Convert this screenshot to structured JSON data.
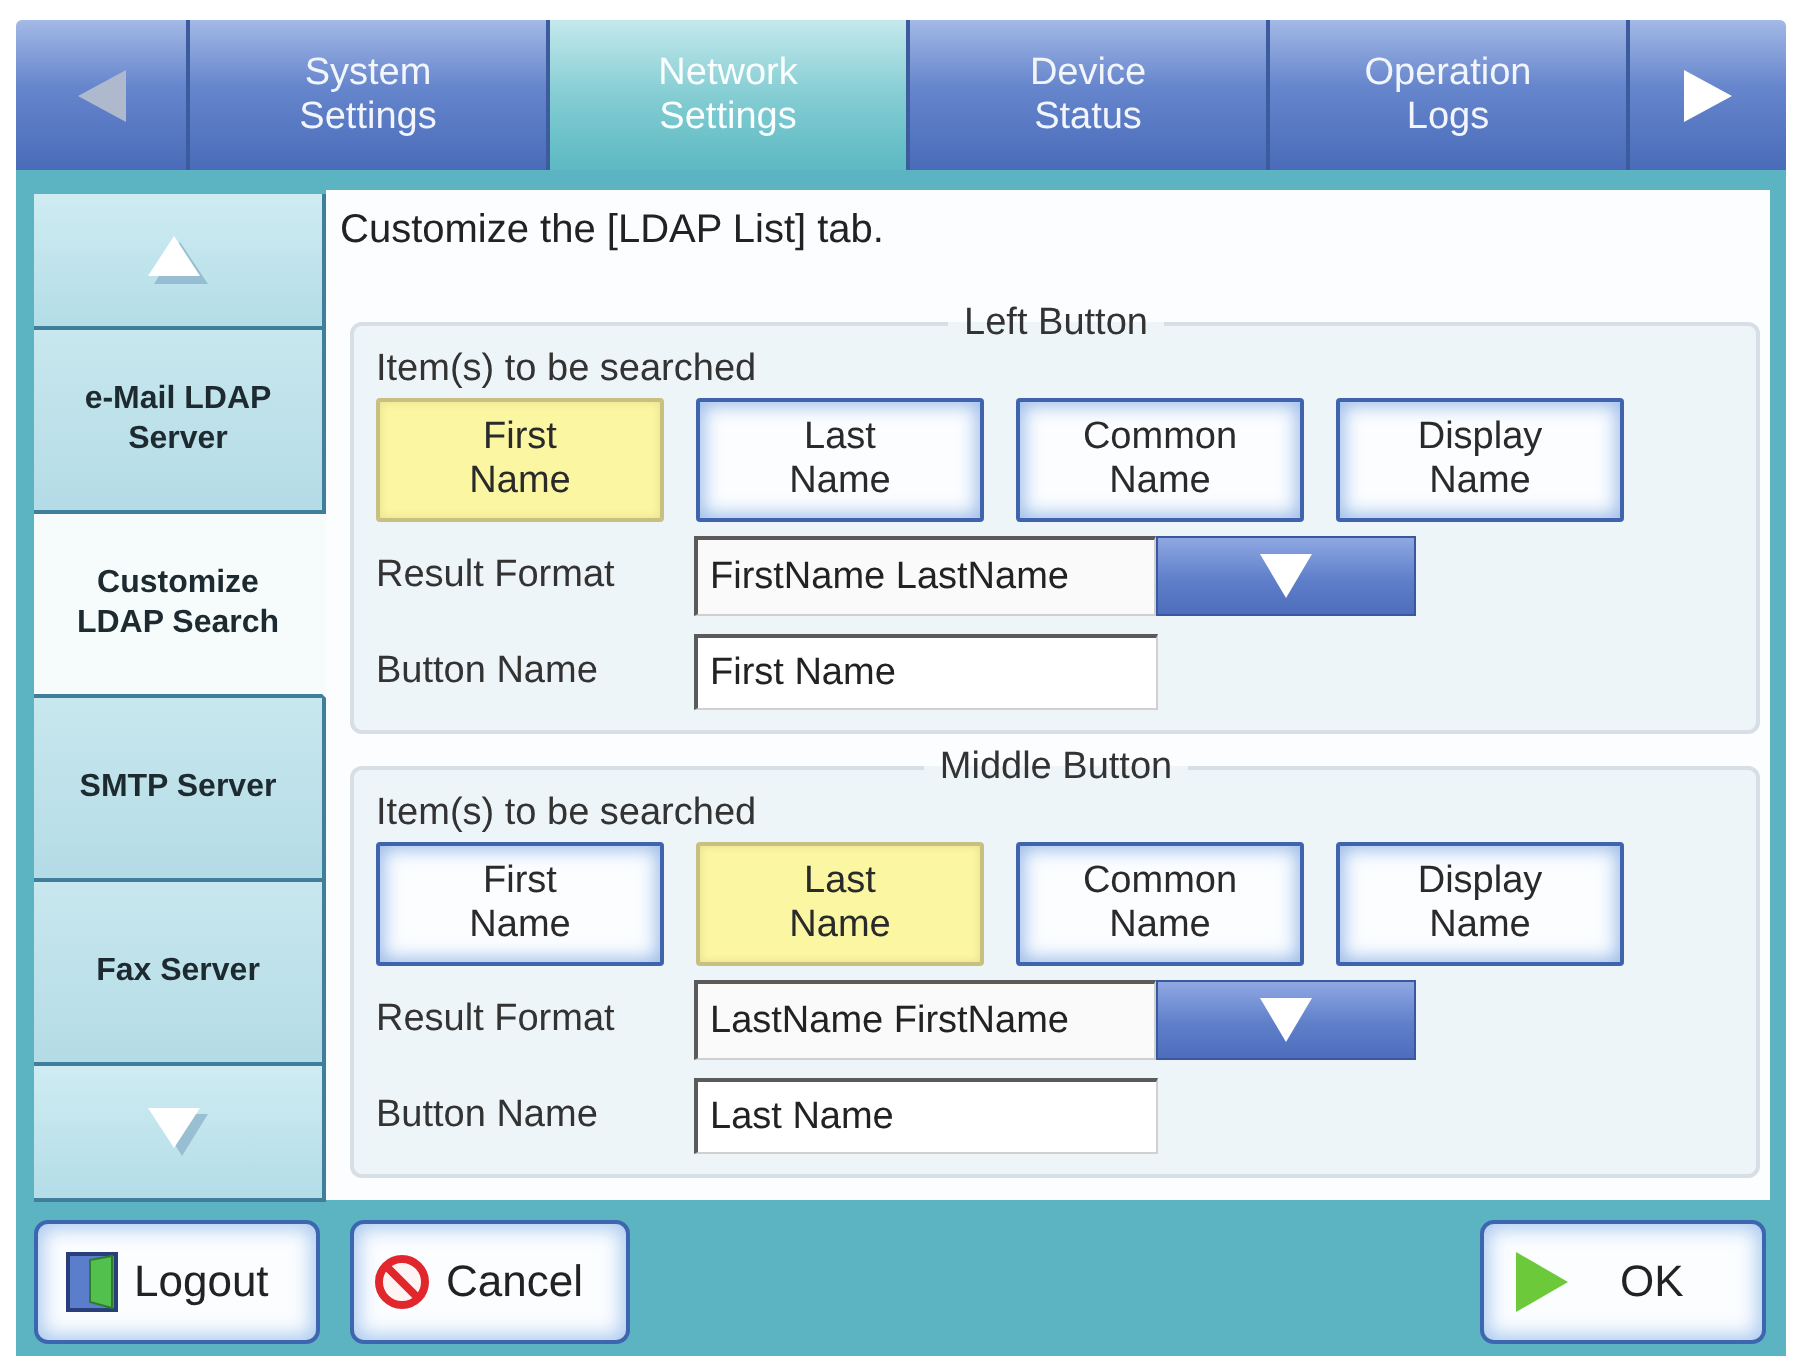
{
  "nav": {
    "prev": {
      "disabled": true
    },
    "tabs": [
      {
        "label": "System Settings",
        "selected": false
      },
      {
        "label": "Network Settings",
        "selected": true
      },
      {
        "label": "Device Status",
        "selected": false
      },
      {
        "label": "Operation Logs",
        "selected": false
      }
    ],
    "next": {
      "disabled": false
    }
  },
  "sidebar": {
    "items": [
      {
        "label": "e-Mail LDAP Server",
        "selected": false
      },
      {
        "label": "Customize LDAP Search",
        "selected": true
      },
      {
        "label": "SMTP Server",
        "selected": false
      },
      {
        "label": "Fax Server",
        "selected": false
      }
    ]
  },
  "content": {
    "instruction": "Customize the [LDAP List] tab.",
    "groups": [
      {
        "title": "Left Button",
        "items_label": "Item(s) to be searched",
        "options": [
          {
            "label": "First Name",
            "selected": true
          },
          {
            "label": "Last Name",
            "selected": false
          },
          {
            "label": "Common Name",
            "selected": false
          },
          {
            "label": "Display Name",
            "selected": false
          }
        ],
        "result_format": {
          "label": "Result Format",
          "value": "FirstName LastName"
        },
        "button_name": {
          "label": "Button Name",
          "value": "First Name"
        }
      },
      {
        "title": "Middle Button",
        "items_label": "Item(s) to be searched",
        "options": [
          {
            "label": "First Name",
            "selected": false
          },
          {
            "label": "Last Name",
            "selected": true
          },
          {
            "label": "Common Name",
            "selected": false
          },
          {
            "label": "Display Name",
            "selected": false
          }
        ],
        "result_format": {
          "label": "Result Format",
          "value": "LastName FirstName"
        },
        "button_name": {
          "label": "Button Name",
          "value": "Last Name"
        }
      }
    ]
  },
  "footer": {
    "buttons": [
      {
        "kind": "logout",
        "label": "Logout"
      },
      {
        "kind": "cancel",
        "label": "Cancel"
      },
      {
        "kind": "ok",
        "label": "OK"
      }
    ]
  }
}
